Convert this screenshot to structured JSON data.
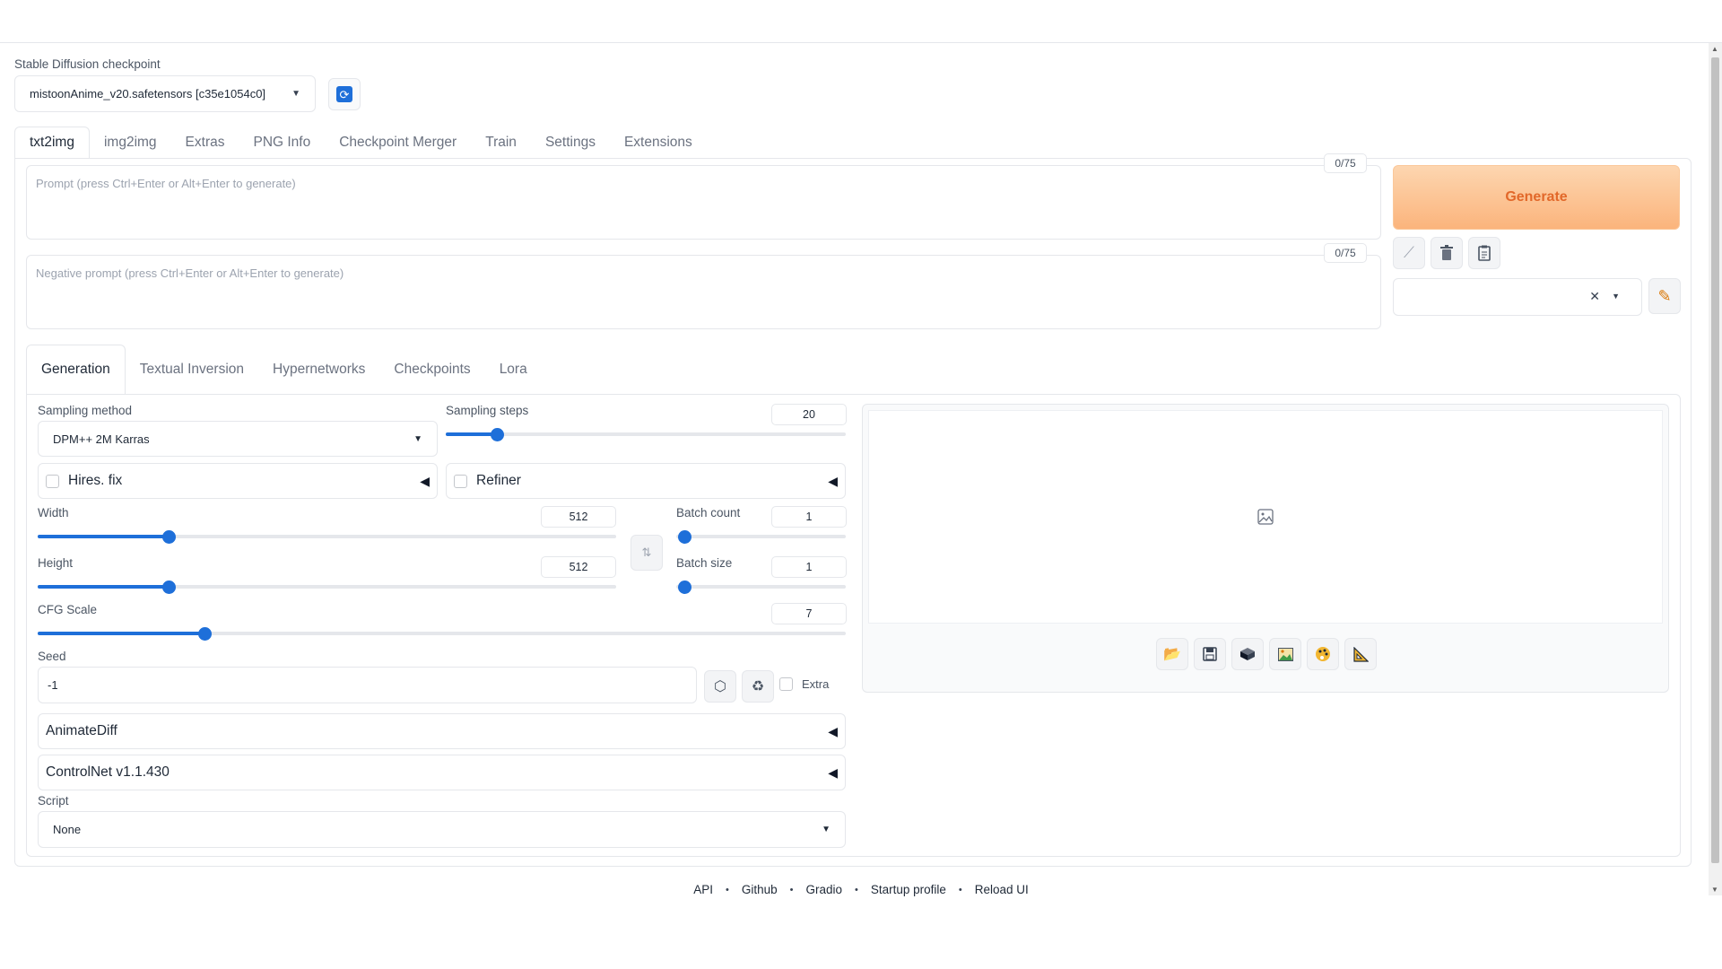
{
  "checkpoint": {
    "label": "Stable Diffusion checkpoint",
    "value": "mistoonAnime_v20.safetensors [c35e1054c0]",
    "refresh_icon": "refresh-icon"
  },
  "main_tabs": [
    "txt2img",
    "img2img",
    "Extras",
    "PNG Info",
    "Checkpoint Merger",
    "Train",
    "Settings",
    "Extensions"
  ],
  "prompt": {
    "placeholder": "Prompt (press Ctrl+Enter or Alt+Enter to generate)",
    "token_count": "0/75"
  },
  "negative_prompt": {
    "placeholder": "Negative prompt (press Ctrl+Enter or Alt+Enter to generate)",
    "token_count": "0/75"
  },
  "generate_label": "Generate",
  "tool_icons": [
    "pencil-icon",
    "trash-icon",
    "clipboard-icon",
    "edit-style-icon"
  ],
  "sub_tabs": [
    "Generation",
    "Textual Inversion",
    "Hypernetworks",
    "Checkpoints",
    "Lora"
  ],
  "sampling_method": {
    "label": "Sampling method",
    "value": "DPM++ 2M Karras"
  },
  "sampling_steps": {
    "label": "Sampling steps",
    "value": "20",
    "min": 1,
    "max": 150
  },
  "hires_fix": {
    "label": "Hires. fix",
    "checked": false
  },
  "refiner": {
    "label": "Refiner",
    "checked": false
  },
  "width": {
    "label": "Width",
    "value": "512",
    "min": 64,
    "max": 2048
  },
  "height": {
    "label": "Height",
    "value": "512",
    "min": 64,
    "max": 2048
  },
  "batch_count": {
    "label": "Batch count",
    "value": "1"
  },
  "batch_size": {
    "label": "Batch size",
    "value": "1"
  },
  "cfg_scale": {
    "label": "CFG Scale",
    "value": "7",
    "min": 1,
    "max": 30
  },
  "seed": {
    "label": "Seed",
    "value": "-1",
    "extra_label": "Extra"
  },
  "accordions": [
    "AnimateDiff",
    "ControlNet v1.1.430"
  ],
  "script": {
    "label": "Script",
    "value": "None"
  },
  "output_icons": [
    "folder-icon",
    "save-icon",
    "zip-icon",
    "image-icon",
    "palette-icon",
    "ruler-icon"
  ],
  "footer_links": [
    "API",
    "Github",
    "Gradio",
    "Startup profile",
    "Reload UI"
  ],
  "colors": {
    "accent": "#1e6fd9",
    "generate_text": "#e2682a",
    "generate_bg": "#fbb47c"
  }
}
